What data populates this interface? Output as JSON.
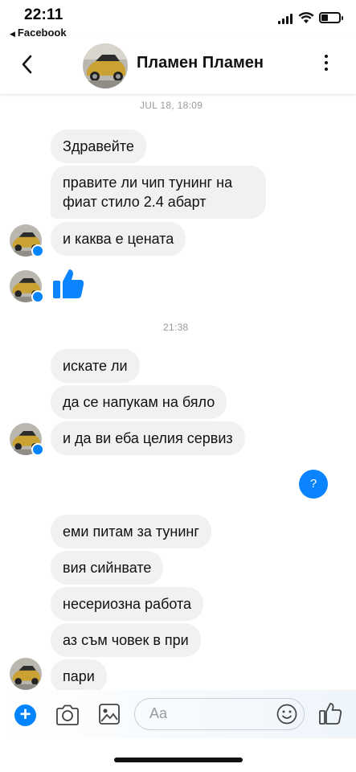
{
  "status_bar": {
    "time": "22:11",
    "back_app": "Facebook"
  },
  "header": {
    "contact_name": "Пламен Пламен"
  },
  "conversation": {
    "timestamp_1": "JUL 18, 18:09",
    "timestamp_2": "21:38",
    "received_messages": [
      "Здравейте",
      "правите ли чип тунинг на фиат стило 2.4 абарт",
      "и каква е цената",
      "искате ли",
      "да се напукам на бяло",
      "и да ви еба целия сервиз",
      "еми питам за тунинг",
      "вия сийнвате",
      "несериозна работа",
      "аз съм човек в при",
      "пари"
    ],
    "sent_message": "?"
  },
  "composer": {
    "placeholder": "Aa"
  },
  "colors": {
    "accent": "#0084ff",
    "bubble_received": "#f1f1f2",
    "timestamp": "#9a9a9a"
  },
  "icons": [
    "back-chevron",
    "menu-dots",
    "like-thumb",
    "plus",
    "camera",
    "gallery",
    "emoji",
    "thumbs-up"
  ]
}
